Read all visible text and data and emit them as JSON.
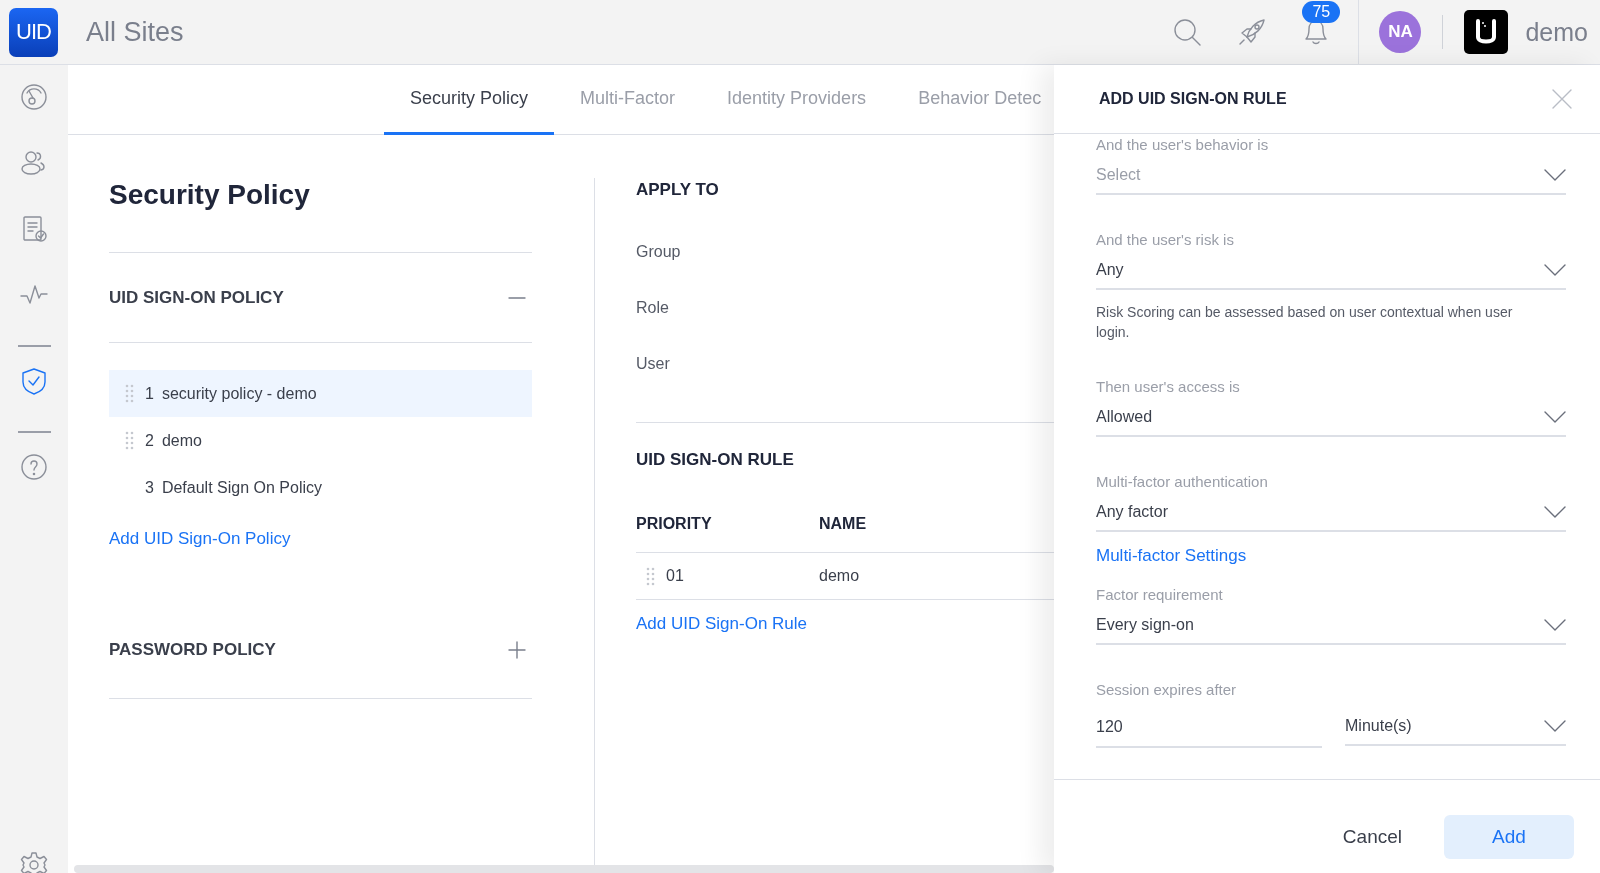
{
  "header": {
    "logo": "UID",
    "site": "All Sites",
    "notifications": "75",
    "avatar": "NA",
    "org": "demo"
  },
  "sidebar": {
    "items": [
      {
        "kind": "dashboard",
        "selected": false
      },
      {
        "kind": "users",
        "selected": false
      },
      {
        "kind": "report",
        "selected": false
      },
      {
        "kind": "activity",
        "selected": false
      },
      {
        "kind": "divider"
      },
      {
        "kind": "shield",
        "selected": true
      },
      {
        "kind": "divider"
      },
      {
        "kind": "help",
        "selected": false
      }
    ],
    "footer": {
      "kind": "settings",
      "selected": false
    }
  },
  "tabs": [
    {
      "label": "Security Policy",
      "selected": true
    },
    {
      "label": "Multi-Factor",
      "selected": false
    },
    {
      "label": "Identity Providers",
      "selected": false
    },
    {
      "label": "Behavior Detec",
      "selected": false
    }
  ],
  "policy_list": {
    "title": "Security Policy",
    "sections": [
      {
        "title": "UID SIGN-ON POLICY",
        "expanded": true,
        "policies": [
          {
            "number": "1",
            "name": "security policy - demo",
            "selected": true,
            "draggable": true
          },
          {
            "number": "2",
            "name": "demo",
            "selected": false,
            "draggable": true
          },
          {
            "number": "3",
            "name": "Default Sign On Policy",
            "selected": false,
            "draggable": false
          }
        ],
        "add_link": "Add UID Sign-On Policy"
      },
      {
        "title": "PASSWORD POLICY",
        "expanded": false
      }
    ]
  },
  "apply_to": {
    "title": "APPLY TO",
    "rows": [
      "Group",
      "Role",
      "User"
    ]
  },
  "rules": {
    "title": "UID SIGN-ON RULE",
    "columns": [
      "PRIORITY",
      "NAME"
    ],
    "rows": [
      {
        "priority": "01",
        "name": "demo"
      }
    ],
    "add_link": "Add UID Sign-On Rule"
  },
  "panel": {
    "title": "ADD UID SIGN-ON RULE",
    "fields": [
      {
        "kind": "select",
        "label": "And the user's behavior is",
        "placeholder": "Select"
      },
      {
        "kind": "select",
        "label": "And the user's risk is",
        "value": "Any"
      },
      {
        "kind": "note",
        "text": "Risk Scoring can be assessed based on user contextual when user login."
      },
      {
        "kind": "select",
        "label": "Then user's access is",
        "value": "Allowed"
      },
      {
        "kind": "select",
        "label": "Multi-factor authentication",
        "value": "Any factor"
      },
      {
        "kind": "link",
        "text": "Multi-factor Settings"
      },
      {
        "kind": "select",
        "label": "Factor requirement",
        "value": "Every sign-on"
      },
      {
        "kind": "duration",
        "label": "Session expires after",
        "value": "120",
        "unit": "Minute(s)"
      }
    ],
    "buttons": [
      {
        "kind": "secondary",
        "label": "Cancel"
      },
      {
        "kind": "primary",
        "label": "Add"
      }
    ]
  }
}
